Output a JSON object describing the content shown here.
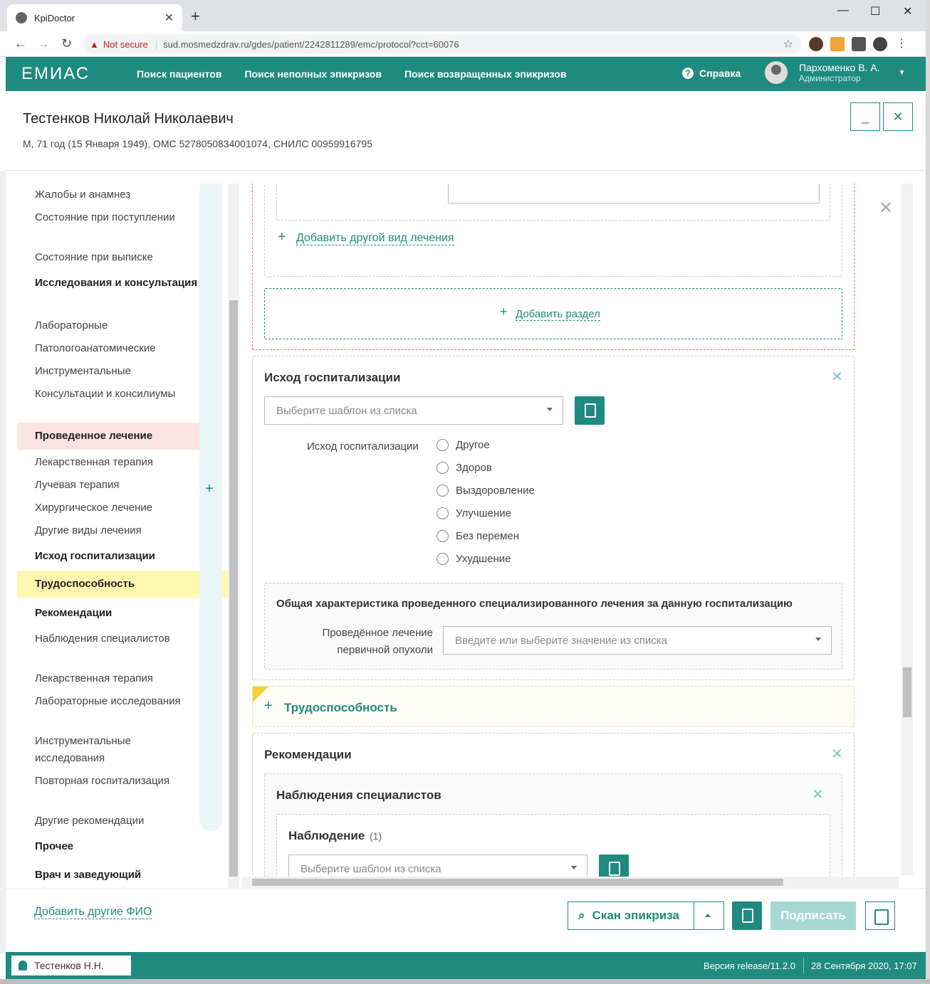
{
  "browser": {
    "tab_title": "KpiDoctor",
    "security_label": "Not secure",
    "url": "sud.mosmedzdrav.ru/gdes/patient/2242811289/emc/protocol?cct=60076"
  },
  "app": {
    "logo": "ЕМИАС",
    "nav": [
      "Поиск пациентов",
      "Поиск неполных эпикризов",
      "Поиск возвращенных эпикризов"
    ],
    "help": "Справка",
    "user_name": "Пархоменко В. А.",
    "user_role": "Администратор"
  },
  "patient": {
    "name": "Тестенков Николай Николаевич",
    "info": "М, 71 год (15 Января 1949), ОМС 5278050834001074, СНИЛС 00959916795"
  },
  "sidebar": {
    "items": [
      {
        "label": "Жалобы и анамнез"
      },
      {
        "label": "Состояние при поступлении"
      },
      {
        "label": "Состояние при выписке"
      },
      {
        "label": "Исследования и консультация"
      },
      {
        "label": "Лабораторные"
      },
      {
        "label": "Патологоанатомические"
      },
      {
        "label": "Инструментальные"
      },
      {
        "label": "Консультации и консилиумы"
      },
      {
        "label": "Проведенное лечение"
      },
      {
        "label": "Лекарственная терапия"
      },
      {
        "label": "Лучевая терапия"
      },
      {
        "label": "Хирургическое лечение"
      },
      {
        "label": "Другие виды лечения"
      },
      {
        "label": "Исход госпитализации"
      },
      {
        "label": "Трудоспособность"
      },
      {
        "label": "Рекомендации"
      },
      {
        "label": "Наблюдения специалистов"
      },
      {
        "label": "Лекарственная терапия"
      },
      {
        "label": "Лабораторные исследования"
      },
      {
        "label": "Инструментальные исследования"
      },
      {
        "label": "Повторная госпитализация"
      },
      {
        "label": "Другие рекомендации"
      },
      {
        "label": "Прочее"
      },
      {
        "label": "Врач и заведующий"
      }
    ]
  },
  "main": {
    "add_other_treatment": "Добавить другой вид лечения",
    "add_section": "Добавить раздел",
    "outcome": {
      "title": "Исход госпитализации",
      "template_placeholder": "Выберите шаблон из списка",
      "field_label": "Исход госпитализации",
      "options": [
        "Другое",
        "Здоров",
        "Выздоровление",
        "Улучшение",
        "Без перемен",
        "Ухудшение"
      ],
      "char_title": "Общая характеристика проведенного специализированного лечения за данную госпитализацию",
      "tumor_label": "Проведённое лечение первичной опухоли",
      "tumor_placeholder": "Введите или выберите значение из списка"
    },
    "work_ability": "Трудоспособность",
    "recommendations": {
      "title": "Рекомендации",
      "specialists_title": "Наблюдения специалистов",
      "observation_title": "Наблюдение",
      "observation_count": "(1)",
      "template_placeholder": "Выберите шаблон из списка"
    }
  },
  "footer": {
    "add_fio": "Добавить другие ФИО",
    "scan": "Скан эпикриза",
    "sign": "Подписать"
  },
  "status": {
    "user": "Тестенков Н.Н.",
    "version": "Версия release/11.2.0",
    "datetime": "28 Сентября 2020, 17:07"
  }
}
